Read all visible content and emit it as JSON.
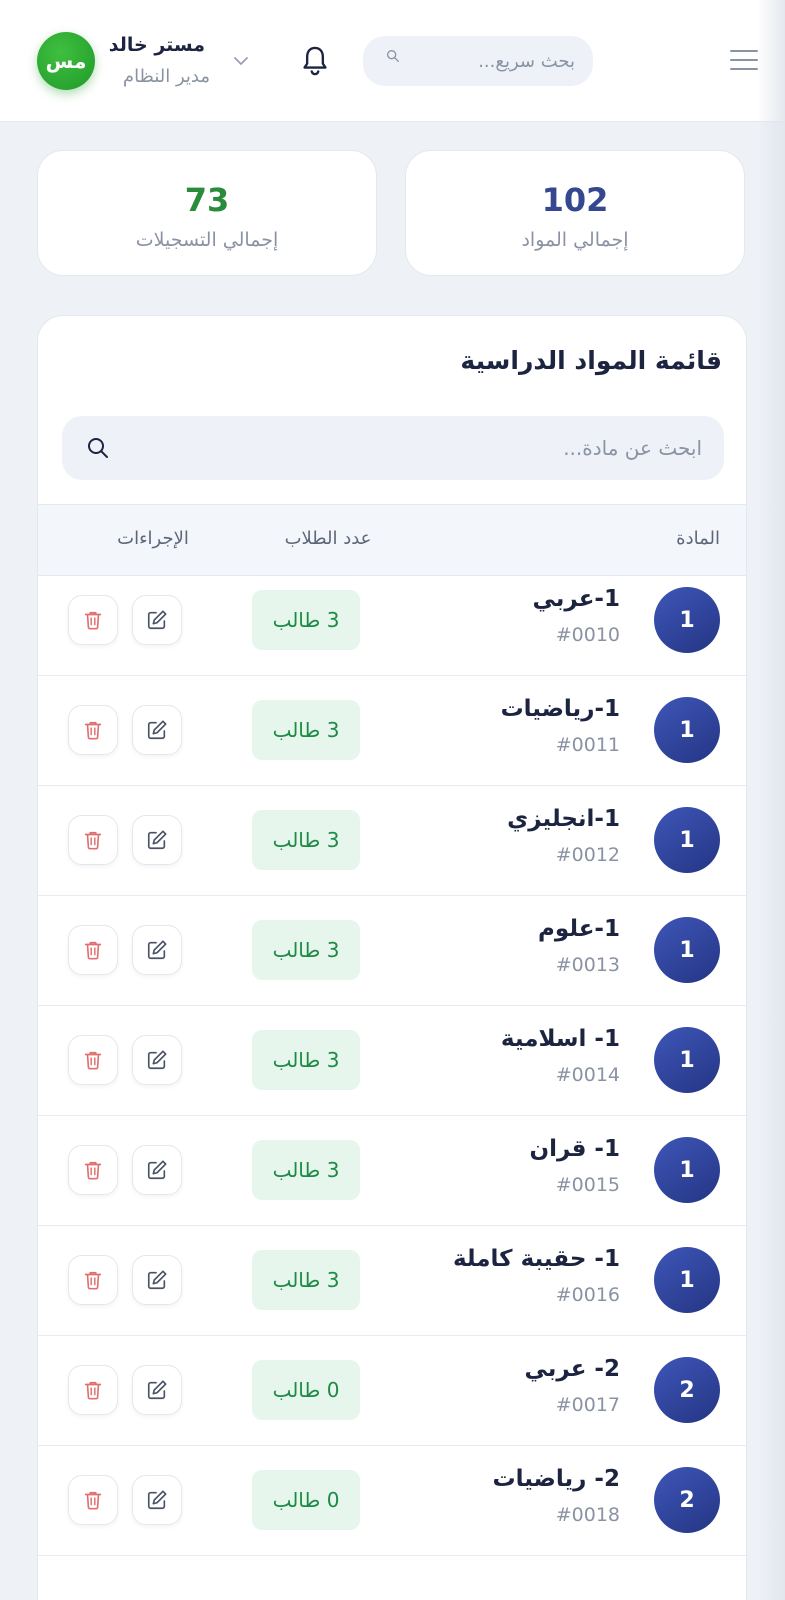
{
  "header": {
    "search_placeholder": "بحث سريع...",
    "user_name": "مستر خالد",
    "user_role": "مدير النظام",
    "avatar_initials": "مس",
    "icons": [
      "menu-icon",
      "search-icon",
      "bell-icon",
      "chevron-down-icon"
    ]
  },
  "stats": {
    "subjects_value": "102",
    "subjects_label": "إجمالي المواد",
    "registrations_value": "73",
    "registrations_label": "إجمالي التسجيلات"
  },
  "panel": {
    "title": "قائمة المواد الدراسية",
    "search_placeholder": "ابحث عن مادة...",
    "columns": {
      "subject": "المادة",
      "students": "عدد الطلاب",
      "actions": "الإجراءات"
    }
  },
  "rows": [
    {
      "num": "1",
      "name": "1-عربي",
      "code": "#0010",
      "students": "3 طالب"
    },
    {
      "num": "1",
      "name": "1-رياضيات",
      "code": "#0011",
      "students": "3 طالب"
    },
    {
      "num": "1",
      "name": "1-انجليزي",
      "code": "#0012",
      "students": "3 طالب"
    },
    {
      "num": "1",
      "name": "1-علوم",
      "code": "#0013",
      "students": "3 طالب"
    },
    {
      "num": "1",
      "name": "1- اسلامية",
      "code": "#0014",
      "students": "3 طالب"
    },
    {
      "num": "1",
      "name": "1- قران",
      "code": "#0015",
      "students": "3 طالب"
    },
    {
      "num": "1",
      "name": "1- حقيبة كاملة",
      "code": "#0016",
      "students": "3 طالب"
    },
    {
      "num": "2",
      "name": "2- عربي",
      "code": "#0017",
      "students": "0 طالب"
    },
    {
      "num": "2",
      "name": "2- رياضيات",
      "code": "#0018",
      "students": "0 طالب"
    }
  ],
  "colors": {
    "accent_blue": "#2f4299",
    "accent_green": "#2a8c3a",
    "badge_bg": "#e6f6ec",
    "delete_red": "#e07070"
  }
}
